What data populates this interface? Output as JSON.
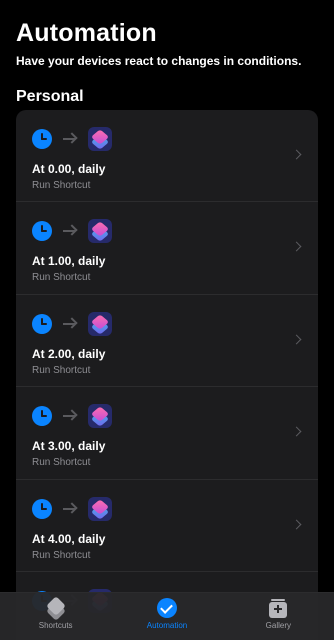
{
  "header": {
    "title": "Automation",
    "subtitle": "Have your devices react to changes in conditions."
  },
  "section": {
    "title": "Personal"
  },
  "automations": [
    {
      "title": "At 0.00, daily",
      "action": "Run Shortcut"
    },
    {
      "title": "At 1.00, daily",
      "action": "Run Shortcut"
    },
    {
      "title": "At 2.00, daily",
      "action": "Run Shortcut"
    },
    {
      "title": "At 3.00, daily",
      "action": "Run Shortcut"
    },
    {
      "title": "At 4.00, daily",
      "action": "Run Shortcut"
    },
    {
      "title": "",
      "action": ""
    }
  ],
  "tabs": [
    {
      "label": "Shortcuts",
      "icon": "stack-icon",
      "active": false
    },
    {
      "label": "Automation",
      "icon": "checkmark-circle-icon",
      "active": true
    },
    {
      "label": "Gallery",
      "icon": "gallery-add-icon",
      "active": false
    }
  ],
  "colors": {
    "accent": "#0a84ff",
    "background": "#000000",
    "card": "#1c1c1e"
  }
}
